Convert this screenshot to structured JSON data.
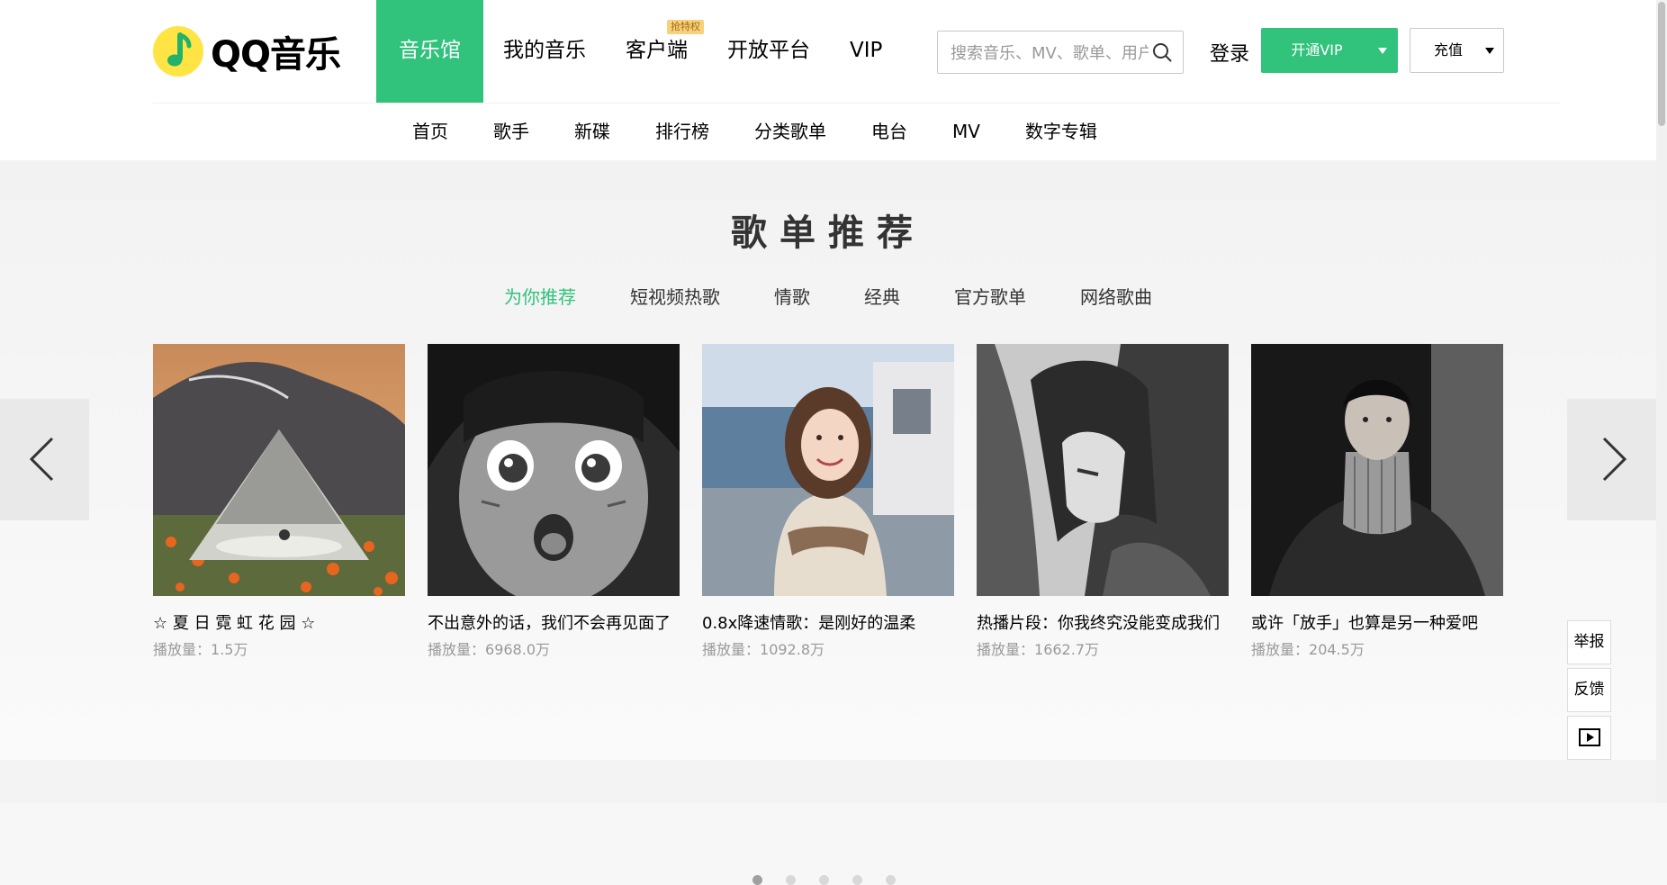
{
  "brand": {
    "name": "QQ音乐",
    "accent": "#31c27c"
  },
  "main_nav": [
    {
      "label": "音乐馆",
      "active": true
    },
    {
      "label": "我的音乐"
    },
    {
      "label": "客户端",
      "badge": "抢特权"
    },
    {
      "label": "开放平台"
    },
    {
      "label": "VIP"
    }
  ],
  "search": {
    "placeholder": "搜索音乐、MV、歌单、用户"
  },
  "header": {
    "login": "登录",
    "vip_button": "开通VIP",
    "recharge_button": "充值"
  },
  "sub_nav": [
    "首页",
    "歌手",
    "新碟",
    "排行榜",
    "分类歌单",
    "电台",
    "MV",
    "数字专辑"
  ],
  "section": {
    "title": "歌单推荐",
    "tabs": [
      "为你推荐",
      "短视频热歌",
      "情歌",
      "经典",
      "官方歌单",
      "网络歌曲"
    ],
    "active_tab": 0,
    "play_label": "播放量：",
    "playlists": [
      {
        "title": "☆ 夏 日 霓 虹 花 园 ☆",
        "plays": "1.5万"
      },
      {
        "title": "不出意外的话，我们不会再见面了",
        "plays": "6968.0万"
      },
      {
        "title": "0.8x降速情歌：是刚好的温柔",
        "plays": "1092.8万"
      },
      {
        "title": "热播片段：你我终究没能变成我们",
        "plays": "1662.7万"
      },
      {
        "title": "或许「放手」也算是另一种爱吧",
        "plays": "204.5万"
      }
    ],
    "page_count": 5,
    "current_page": 1
  },
  "side_tools": {
    "report": "举报",
    "feedback": "反馈"
  }
}
